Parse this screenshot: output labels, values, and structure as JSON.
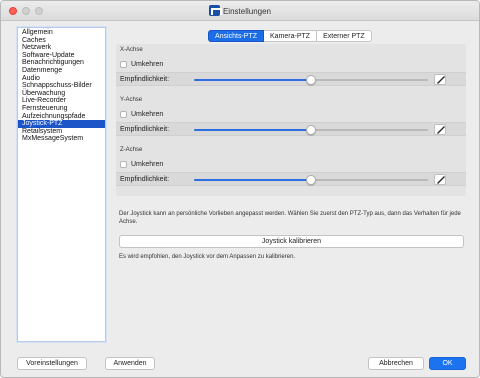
{
  "window": {
    "title": "Einstellungen"
  },
  "sidebar": {
    "items": [
      {
        "label": "Allgemein",
        "selected": false
      },
      {
        "label": "Caches",
        "selected": false
      },
      {
        "label": "Netzwerk",
        "selected": false
      },
      {
        "label": "Software-Update",
        "selected": false
      },
      {
        "label": "Benachrichtigungen",
        "selected": false
      },
      {
        "label": "Datenmenge",
        "selected": false
      },
      {
        "label": "Audio",
        "selected": false
      },
      {
        "label": "Schnappschuss-Bilder",
        "selected": false
      },
      {
        "label": "Überwachung",
        "selected": false
      },
      {
        "label": "Live-Recorder",
        "selected": false
      },
      {
        "label": "Fernsteuerung",
        "selected": false
      },
      {
        "label": "Aufzeichnungspfade",
        "selected": false
      },
      {
        "label": "Joystick-PTZ",
        "selected": true
      },
      {
        "label": "Retailsystem",
        "selected": false
      },
      {
        "label": "MxMessageSystem",
        "selected": false
      }
    ]
  },
  "tabs": [
    {
      "label": "Ansichts-PTZ",
      "active": true
    },
    {
      "label": "Kamera-PTZ",
      "active": false
    },
    {
      "label": "Externer PTZ",
      "active": false
    }
  ],
  "axes": [
    {
      "title": "X-Achse",
      "invert_label": "Umkehren",
      "invert_checked": false,
      "sensitivity_label": "Empfindlichkeit:",
      "sensitivity_value": 0.5
    },
    {
      "title": "Y-Achse",
      "invert_label": "Umkehren",
      "invert_checked": false,
      "sensitivity_label": "Empfindlichkeit:",
      "sensitivity_value": 0.5
    },
    {
      "title": "Z-Achse",
      "invert_label": "Umkehren",
      "invert_checked": false,
      "sensitivity_label": "Empfindlichkeit:",
      "sensitivity_value": 0.5
    }
  ],
  "info_text": "Der Joystick kann an persönliche Vorlieben angepasst werden. Wählen Sie zuerst den PTZ-Typ aus, dann das Verhalten für jede Achse.",
  "calibrate_button": "Joystick kalibrieren",
  "hint_text": "Es wird empfohlen, den Joystick vor dem Anpassen zu kalibrieren.",
  "footer": {
    "defaults_button": "Voreinstellungen",
    "apply_button": "Anwenden",
    "cancel_button": "Abbrechen",
    "ok_button": "OK"
  },
  "colors": {
    "accent": "#1b6ee6",
    "selection": "#1b55c8",
    "close": "#fe5f57"
  }
}
